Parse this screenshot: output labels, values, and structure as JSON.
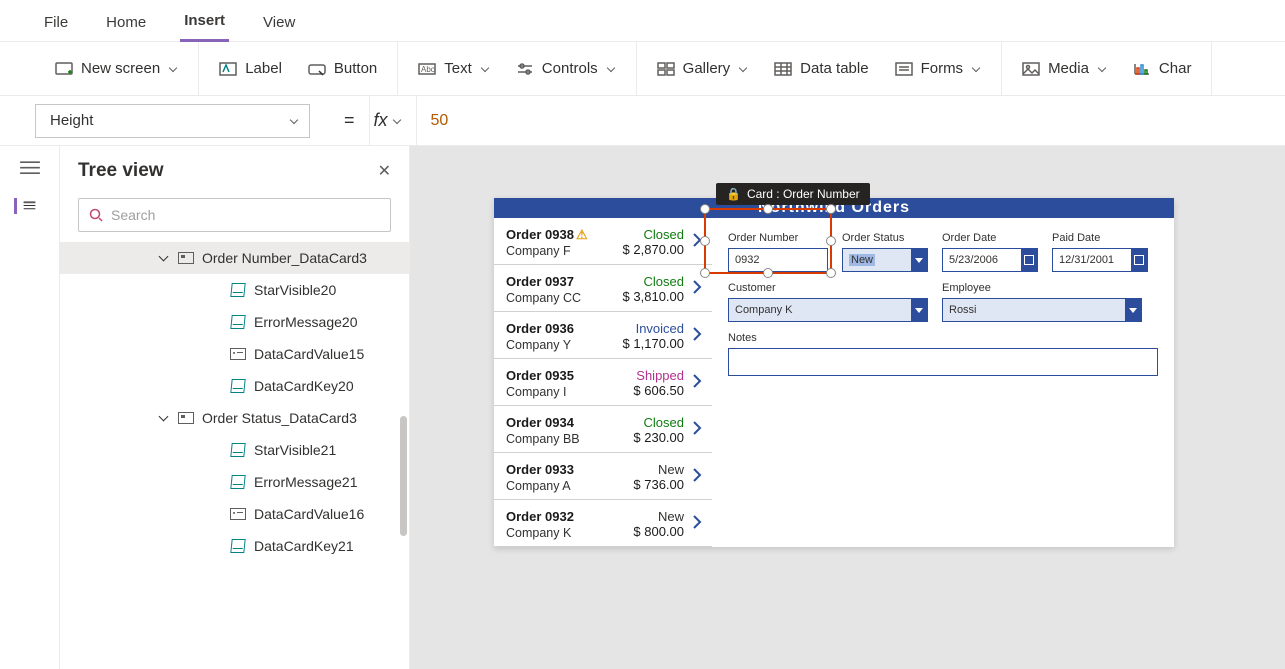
{
  "menu": {
    "file": "File",
    "home": "Home",
    "insert": "Insert",
    "view": "View",
    "active": "Insert"
  },
  "ribbon": {
    "newscreen": "New screen",
    "label": "Label",
    "button": "Button",
    "text": "Text",
    "controls": "Controls",
    "gallery": "Gallery",
    "datatable": "Data table",
    "forms": "Forms",
    "media": "Media",
    "chart": "Char"
  },
  "formulabar": {
    "property": "Height",
    "value": "50"
  },
  "tree": {
    "title": "Tree view",
    "search_placeholder": "Search",
    "groups": [
      {
        "name": "Order Number_DataCard3",
        "children": [
          "StarVisible20",
          "ErrorMessage20",
          "DataCardValue15",
          "DataCardKey20"
        ]
      },
      {
        "name": "Order Status_DataCard3",
        "children": [
          "StarVisible21",
          "ErrorMessage21",
          "DataCardValue16",
          "DataCardKey21"
        ]
      }
    ]
  },
  "app": {
    "title_fragment": "Northwind Orders",
    "orders": [
      {
        "id": "Order 0938",
        "company": "Company F",
        "status": "Closed",
        "amount": "$ 2,870.00",
        "warn": true
      },
      {
        "id": "Order 0937",
        "company": "Company CC",
        "status": "Closed",
        "amount": "$ 3,810.00"
      },
      {
        "id": "Order 0936",
        "company": "Company Y",
        "status": "Invoiced",
        "amount": "$ 1,170.00"
      },
      {
        "id": "Order 0935",
        "company": "Company I",
        "status": "Shipped",
        "amount": "$ 606.50"
      },
      {
        "id": "Order 0934",
        "company": "Company BB",
        "status": "Closed",
        "amount": "$ 230.00"
      },
      {
        "id": "Order 0933",
        "company": "Company A",
        "status": "New",
        "amount": "$ 736.00"
      },
      {
        "id": "Order 0932",
        "company": "Company K",
        "status": "New",
        "amount": "$ 800.00"
      }
    ],
    "form": {
      "order_number_label": "Order Number",
      "order_number": "0932",
      "order_status_label": "Order Status",
      "order_status": "New",
      "order_date_label": "Order Date",
      "order_date": "5/23/2006",
      "paid_date_label": "Paid Date",
      "paid_date": "12/31/2001",
      "customer_label": "Customer",
      "customer": "Company K",
      "employee_label": "Employee",
      "employee": "Rossi",
      "notes_label": "Notes"
    },
    "selection_tag": "Card : Order Number"
  }
}
